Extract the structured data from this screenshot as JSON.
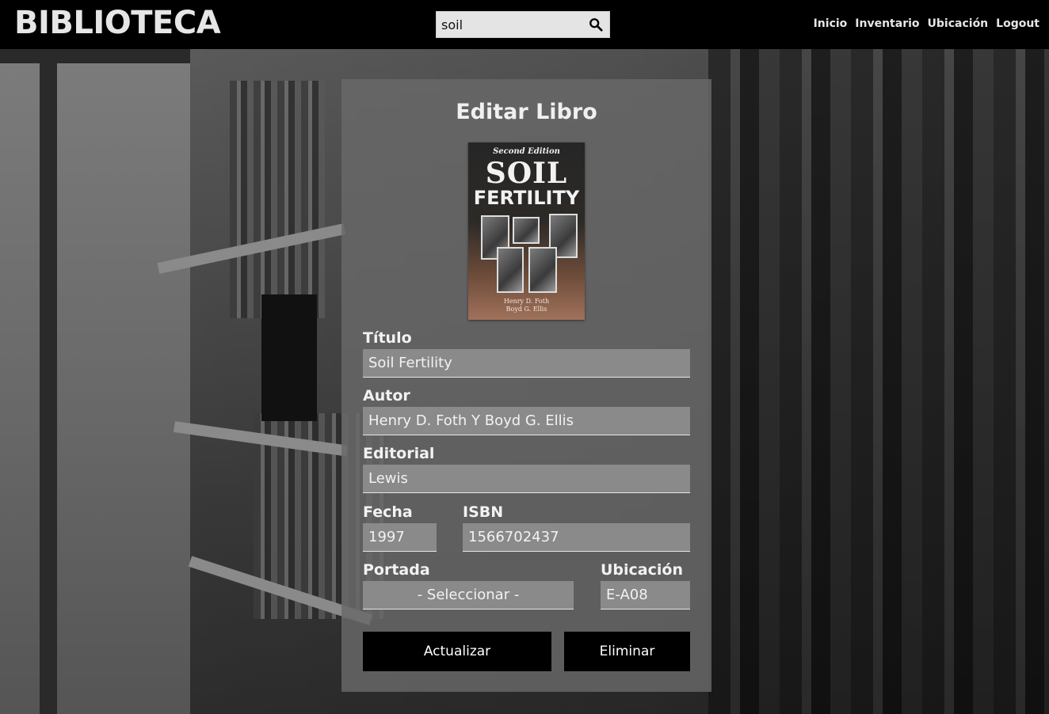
{
  "header": {
    "brand": "BIBLIOTECA",
    "search": {
      "value": "soil",
      "placeholder": ""
    },
    "nav": [
      {
        "label": "Inicio"
      },
      {
        "label": "Inventario"
      },
      {
        "label": "Ubicación"
      },
      {
        "label": "Logout"
      }
    ]
  },
  "form": {
    "title": "Editar Libro",
    "cover": {
      "edition": "Second Edition",
      "title_line1": "SOIL",
      "title_line2": "FERTILITY",
      "authors_line1": "Henry D. Foth",
      "authors_line2": "Boyd G. Ellis"
    },
    "fields": {
      "titulo": {
        "label": "Título",
        "value": "Soil Fertility"
      },
      "autor": {
        "label": "Autor",
        "value": "Henry D. Foth Y Boyd G. Ellis"
      },
      "editorial": {
        "label": "Editorial",
        "value": "Lewis"
      },
      "fecha": {
        "label": "Fecha",
        "value": "1997"
      },
      "isbn": {
        "label": "ISBN",
        "value": "1566702437"
      },
      "portada": {
        "label": "Portada",
        "value": "- Seleccionar -"
      },
      "ubicacion": {
        "label": "Ubicación",
        "value": "E-A08"
      }
    },
    "buttons": {
      "update": "Actualizar",
      "delete": "Eliminar"
    }
  },
  "colors": {
    "topbar": "#000000",
    "card": "#696969",
    "field": "#8a8a8a",
    "button": "#000000"
  }
}
